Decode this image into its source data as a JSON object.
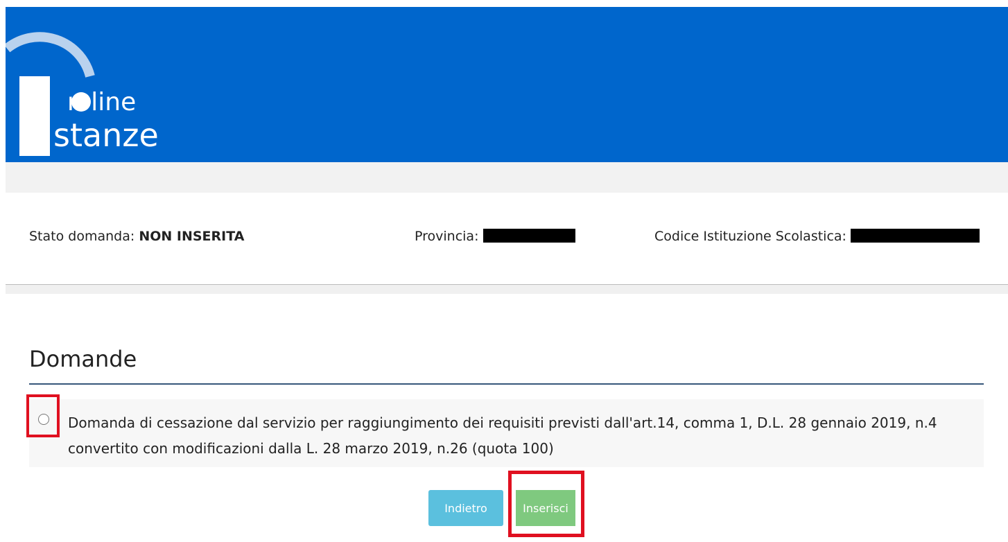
{
  "header": {
    "logo_line1": "n line",
    "logo_line2": "stanze",
    "brand_color": "#0066cc"
  },
  "info": {
    "stato_label": "Stato domanda:",
    "stato_value": "NON INSERITA",
    "provincia_label": "Provincia:",
    "codice_label": "Codice Istituzione Scolastica:"
  },
  "section": {
    "title": "Domande"
  },
  "options": [
    {
      "label": "Domanda di cessazione dal servizio per raggiungimento dei requisiti previsti dall'art.14, comma 1, D.L. 28 gennaio 2019, n.4 convertito con modificazioni dalla L. 28 marzo 2019, n.26 (quota 100)",
      "selected": false
    }
  ],
  "buttons": {
    "back_label": "Indietro",
    "insert_label": "Inserisci"
  },
  "colors": {
    "highlight": "#e01020",
    "back_button": "#5bc0de",
    "insert_button": "#7fc97f"
  }
}
